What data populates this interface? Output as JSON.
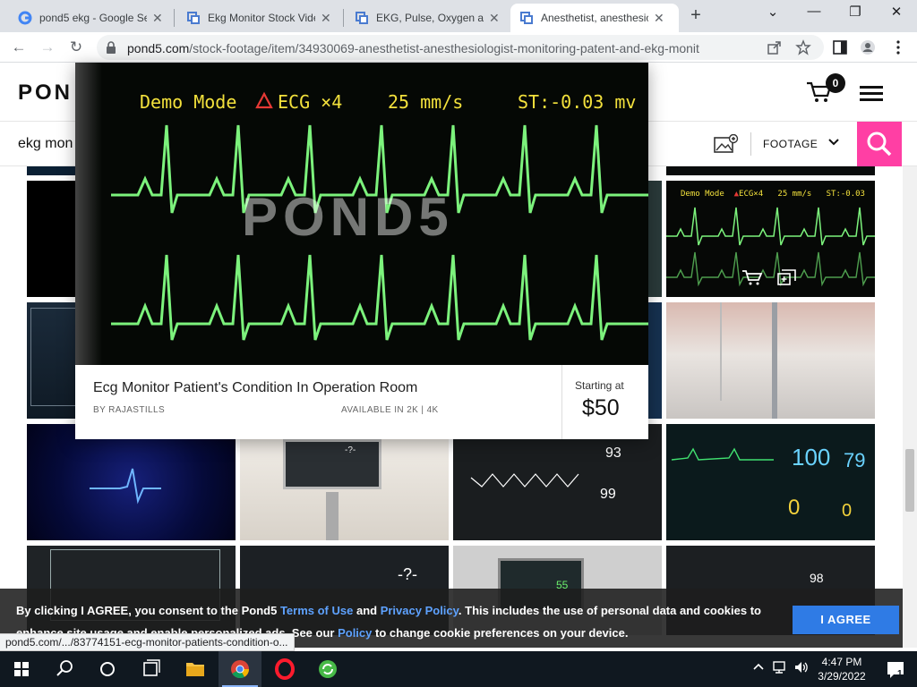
{
  "browser": {
    "tabs": [
      {
        "title": "pond5 ekg - Google Se",
        "close": "✕"
      },
      {
        "title": "Ekg Monitor Stock Vide",
        "close": "✕"
      },
      {
        "title": "EKG, Pulse, Oxygen and",
        "close": "✕"
      },
      {
        "title": "Anesthetist, anesthesio",
        "close": "✕"
      }
    ],
    "new_tab": "+",
    "window_controls": {
      "minimize": "—",
      "maximize": "❐",
      "close": "✕",
      "tabsearch": "⌄"
    },
    "nav": {
      "back": "←",
      "forward": "→",
      "reload": "↻"
    },
    "url_host": "pond5.com",
    "url_path": "/stock-footage/item/34930069-anesthetist-anesthesiologist-monitoring-patent-and-ekg-monit",
    "status_url": "pond5.com/.../83774151-ecg-monitor-patients-condition-o..."
  },
  "site": {
    "logo": "PON",
    "cart_count": "0",
    "search_query": "ekg mon",
    "media_type": "FOOTAGE",
    "accent": "#ff3fa4"
  },
  "card": {
    "ecg_demo": "Demo Mode",
    "ecg_lead": "ECG ×4",
    "ecg_speed": "25 mm/s",
    "ecg_st": "ST:-0.03 mv",
    "watermark": "POND5",
    "title": "Ecg Monitor Patient's Condition In Operation Room",
    "by": "BY RAJASTILLS",
    "available": "AVAILABLE IN 2K | 4K",
    "starting_label": "Starting at",
    "price": "$50"
  },
  "grid_overlays": {
    "thumb1_demo": "Demo Mode",
    "thumb1_lead": "ECG×4",
    "thumb1_speed": "25 mm/s",
    "thumb1_st": "ST:-0.03",
    "monitor_values": [
      "-?-",
      "93",
      "99",
      "100",
      "79",
      "0",
      "0",
      "-?-",
      "55",
      "98"
    ]
  },
  "cookie": {
    "t1": "By clicking I AGREE, you consent to the Pond5 ",
    "terms": "Terms of Use",
    "t2": " and ",
    "privacy": "Privacy Policy",
    "t3": ". This includes the use of personal data and cookies to enhance site usage and enable personalized ads. See our ",
    "policy": "Policy",
    "t4": " to change cookie preferences on your device.",
    "agree": "I AGREE"
  },
  "taskbar": {
    "time": "4:47 PM",
    "date": "3/29/2022",
    "notifications": "1"
  }
}
